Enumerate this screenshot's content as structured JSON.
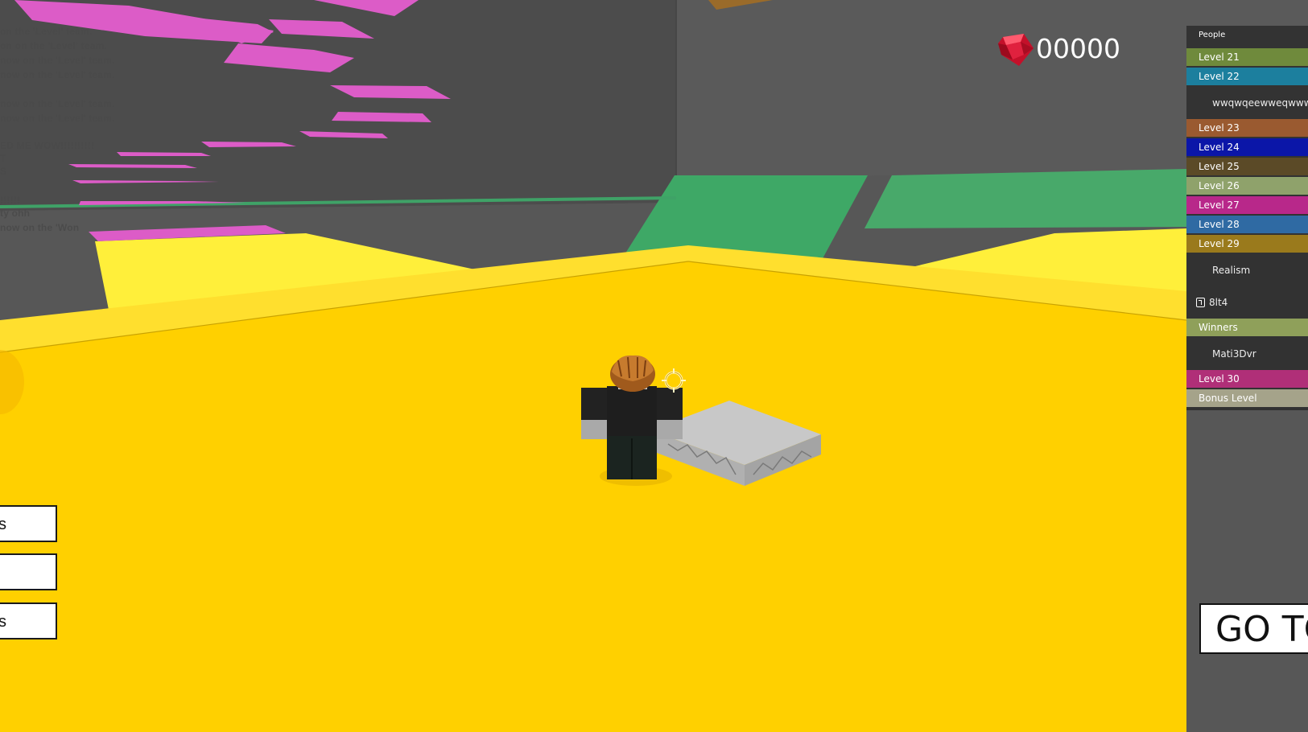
{
  "hud": {
    "gem_count": "00000",
    "gem_icon": "ruby-gem-icon"
  },
  "chat": {
    "lines": [
      "on the 'Level' team.",
      "on on the 'Level' team.",
      "now on the 'Level' team.",
      "now on the 'Level' team.",
      "now on the 'Level' team.",
      "now on the 'Level' team.",
      "ED ME WOW!!!!!!!!!!",
      "T",
      "S",
      "!!!!!!",
      "ty ohh",
      "now on the 'Won"
    ]
  },
  "leaderboard": {
    "header": "People",
    "rows": [
      {
        "kind": "team",
        "label": "Level 21",
        "color": "#6f8a3c"
      },
      {
        "kind": "team",
        "label": "Level 22",
        "color": "#1c7f9e"
      },
      {
        "kind": "player",
        "label": "wwqwqeewweqwww..."
      },
      {
        "kind": "team",
        "label": "Level 23",
        "color": "#9a5a30"
      },
      {
        "kind": "team",
        "label": "Level 24",
        "color": "#0b16a8"
      },
      {
        "kind": "team",
        "label": "Level 25",
        "color": "#5b4a27"
      },
      {
        "kind": "team",
        "label": "Level 26",
        "color": "#8fa26b"
      },
      {
        "kind": "team",
        "label": "Level 27",
        "color": "#b8288a"
      },
      {
        "kind": "team",
        "label": "Level 28",
        "color": "#2f6aa3"
      },
      {
        "kind": "team",
        "label": "Level 29",
        "color": "#9a7a1c"
      },
      {
        "kind": "player",
        "label": "Realism"
      },
      {
        "kind": "player-icon",
        "label": "8lt4",
        "icon": "player-badge-icon"
      },
      {
        "kind": "team",
        "label": "Winners",
        "color": "#8fa05a"
      },
      {
        "kind": "player",
        "label": "Mati3Dvr"
      },
      {
        "kind": "team",
        "label": "Level 30",
        "color": "#b02f78"
      },
      {
        "kind": "team",
        "label": "Bonus Level",
        "color": "#a5a38a"
      }
    ]
  },
  "buttons": {
    "left": [
      "s",
      "",
      "s"
    ],
    "goto": "GO TO"
  },
  "colors": {
    "floor": "#ffd000",
    "wall": "#575757",
    "pink": "#dc5cc7",
    "green": "#3ea866",
    "yellow_edge": "#ffef3a"
  }
}
